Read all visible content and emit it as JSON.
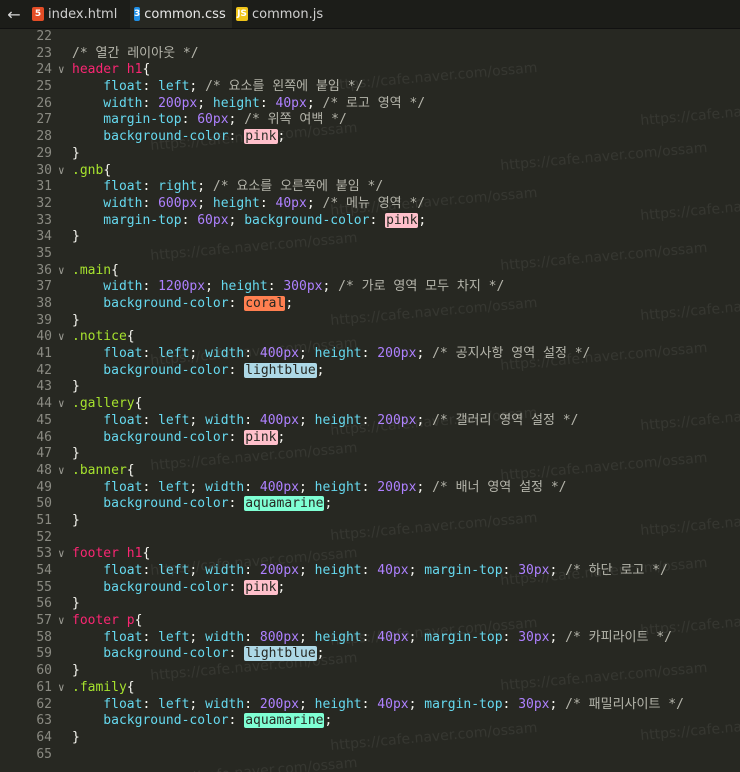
{
  "tabs": [
    {
      "label": "index.html",
      "icon": "html5-icon",
      "badge": "5",
      "color": "#e44d26",
      "active": false
    },
    {
      "label": "common.css",
      "icon": "css3-icon",
      "badge": "3",
      "color": "#1f8fe6",
      "active": true
    },
    {
      "label": "common.js",
      "icon": "js-icon",
      "badge": "JS",
      "color": "#f0c419",
      "active": false
    }
  ],
  "back_glyph": "←",
  "watermark": "https://cafe.naver.com/ossam",
  "colors": {
    "pink": "#ffc0cb",
    "coral": "#ff7f50",
    "lightblue": "#add8e6",
    "aquamarine": "#7fffd4"
  },
  "lines": [
    {
      "n": "22",
      "fold": false,
      "tokens": []
    },
    {
      "n": "23",
      "fold": false,
      "tokens": [
        {
          "t": "/* 열간 레이아웃 */",
          "c": "c"
        }
      ]
    },
    {
      "n": "24",
      "fold": true,
      "tokens": [
        {
          "t": "header h1",
          "c": "sel"
        },
        {
          "t": "{",
          "c": "brace"
        }
      ]
    },
    {
      "n": "25",
      "fold": false,
      "tokens": [
        {
          "t": "    float",
          "c": "prop"
        },
        {
          "t": ": ",
          "c": "punc"
        },
        {
          "t": "left",
          "c": "prop"
        },
        {
          "t": "; ",
          "c": "punc"
        },
        {
          "t": "/* 요소를 왼쪽에 붙임 */",
          "c": "c"
        }
      ]
    },
    {
      "n": "26",
      "fold": false,
      "tokens": [
        {
          "t": "    width",
          "c": "prop"
        },
        {
          "t": ": ",
          "c": "punc"
        },
        {
          "t": "200px",
          "c": "val"
        },
        {
          "t": "; ",
          "c": "punc"
        },
        {
          "t": "height",
          "c": "prop"
        },
        {
          "t": ": ",
          "c": "punc"
        },
        {
          "t": "40px",
          "c": "val"
        },
        {
          "t": "; ",
          "c": "punc"
        },
        {
          "t": "/* 로고 영역 */",
          "c": "c"
        }
      ]
    },
    {
      "n": "27",
      "fold": false,
      "tokens": [
        {
          "t": "    margin-top",
          "c": "prop"
        },
        {
          "t": ": ",
          "c": "punc"
        },
        {
          "t": "60px",
          "c": "val"
        },
        {
          "t": "; ",
          "c": "punc"
        },
        {
          "t": "/* 위쪽 여백 */",
          "c": "c"
        }
      ]
    },
    {
      "n": "28",
      "fold": false,
      "tokens": [
        {
          "t": "    background-color",
          "c": "prop"
        },
        {
          "t": ": ",
          "c": "punc"
        },
        {
          "t": "pink",
          "c": "chip",
          "bg": "pink"
        },
        {
          "t": ";",
          "c": "punc"
        }
      ]
    },
    {
      "n": "29",
      "fold": false,
      "tokens": [
        {
          "t": "}",
          "c": "brace"
        }
      ]
    },
    {
      "n": "30",
      "fold": true,
      "tokens": [
        {
          "t": ".gnb",
          "c": "cls"
        },
        {
          "t": "{",
          "c": "brace"
        }
      ]
    },
    {
      "n": "31",
      "fold": false,
      "tokens": [
        {
          "t": "    float",
          "c": "prop"
        },
        {
          "t": ": ",
          "c": "punc"
        },
        {
          "t": "right",
          "c": "prop"
        },
        {
          "t": "; ",
          "c": "punc"
        },
        {
          "t": "/* 요소를 오른쪽에 붙임 */",
          "c": "c"
        }
      ]
    },
    {
      "n": "32",
      "fold": false,
      "tokens": [
        {
          "t": "    width",
          "c": "prop"
        },
        {
          "t": ": ",
          "c": "punc"
        },
        {
          "t": "600px",
          "c": "val"
        },
        {
          "t": "; ",
          "c": "punc"
        },
        {
          "t": "height",
          "c": "prop"
        },
        {
          "t": ": ",
          "c": "punc"
        },
        {
          "t": "40px",
          "c": "val"
        },
        {
          "t": "; ",
          "c": "punc"
        },
        {
          "t": "/* 메뉴 영역 */",
          "c": "c"
        }
      ]
    },
    {
      "n": "33",
      "fold": false,
      "tokens": [
        {
          "t": "    margin-top",
          "c": "prop"
        },
        {
          "t": ": ",
          "c": "punc"
        },
        {
          "t": "60px",
          "c": "val"
        },
        {
          "t": "; ",
          "c": "punc"
        },
        {
          "t": "background-color",
          "c": "prop"
        },
        {
          "t": ": ",
          "c": "punc"
        },
        {
          "t": "pink",
          "c": "chip",
          "bg": "pink"
        },
        {
          "t": ";",
          "c": "punc"
        }
      ]
    },
    {
      "n": "34",
      "fold": false,
      "tokens": [
        {
          "t": "}",
          "c": "brace"
        }
      ]
    },
    {
      "n": "35",
      "fold": false,
      "tokens": []
    },
    {
      "n": "36",
      "fold": true,
      "tokens": [
        {
          "t": ".main",
          "c": "cls"
        },
        {
          "t": "{",
          "c": "brace"
        }
      ]
    },
    {
      "n": "37",
      "fold": false,
      "tokens": [
        {
          "t": "    width",
          "c": "prop"
        },
        {
          "t": ": ",
          "c": "punc"
        },
        {
          "t": "1200px",
          "c": "val"
        },
        {
          "t": "; ",
          "c": "punc"
        },
        {
          "t": "height",
          "c": "prop"
        },
        {
          "t": ": ",
          "c": "punc"
        },
        {
          "t": "300px",
          "c": "val"
        },
        {
          "t": "; ",
          "c": "punc"
        },
        {
          "t": "/* 가로 영역 모두 차지 */",
          "c": "c"
        }
      ]
    },
    {
      "n": "38",
      "fold": false,
      "tokens": [
        {
          "t": "    background-color",
          "c": "prop"
        },
        {
          "t": ": ",
          "c": "punc"
        },
        {
          "t": "coral",
          "c": "chip",
          "bg": "coral"
        },
        {
          "t": ";",
          "c": "punc"
        }
      ]
    },
    {
      "n": "39",
      "fold": false,
      "tokens": [
        {
          "t": "}",
          "c": "brace"
        }
      ]
    },
    {
      "n": "40",
      "fold": true,
      "tokens": [
        {
          "t": ".notice",
          "c": "cls"
        },
        {
          "t": "{",
          "c": "brace"
        }
      ]
    },
    {
      "n": "41",
      "fold": false,
      "tokens": [
        {
          "t": "    float",
          "c": "prop"
        },
        {
          "t": ": ",
          "c": "punc"
        },
        {
          "t": "left",
          "c": "prop"
        },
        {
          "t": "; ",
          "c": "punc"
        },
        {
          "t": "width",
          "c": "prop"
        },
        {
          "t": ": ",
          "c": "punc"
        },
        {
          "t": "400px",
          "c": "val"
        },
        {
          "t": "; ",
          "c": "punc"
        },
        {
          "t": "height",
          "c": "prop"
        },
        {
          "t": ": ",
          "c": "punc"
        },
        {
          "t": "200px",
          "c": "val"
        },
        {
          "t": "; ",
          "c": "punc"
        },
        {
          "t": "/* 공지사항 영역 설정 */",
          "c": "c"
        }
      ]
    },
    {
      "n": "42",
      "fold": false,
      "tokens": [
        {
          "t": "    background-color",
          "c": "prop"
        },
        {
          "t": ": ",
          "c": "punc"
        },
        {
          "t": "lightblue",
          "c": "chip",
          "bg": "lightblue"
        },
        {
          "t": ";",
          "c": "punc"
        }
      ]
    },
    {
      "n": "43",
      "fold": false,
      "tokens": [
        {
          "t": "}",
          "c": "brace"
        }
      ]
    },
    {
      "n": "44",
      "fold": true,
      "tokens": [
        {
          "t": ".gallery",
          "c": "cls"
        },
        {
          "t": "{",
          "c": "brace"
        }
      ]
    },
    {
      "n": "45",
      "fold": false,
      "tokens": [
        {
          "t": "    float",
          "c": "prop"
        },
        {
          "t": ": ",
          "c": "punc"
        },
        {
          "t": "left",
          "c": "prop"
        },
        {
          "t": "; ",
          "c": "punc"
        },
        {
          "t": "width",
          "c": "prop"
        },
        {
          "t": ": ",
          "c": "punc"
        },
        {
          "t": "400px",
          "c": "val"
        },
        {
          "t": "; ",
          "c": "punc"
        },
        {
          "t": "height",
          "c": "prop"
        },
        {
          "t": ": ",
          "c": "punc"
        },
        {
          "t": "200px",
          "c": "val"
        },
        {
          "t": "; ",
          "c": "punc"
        },
        {
          "t": "/* 갤러리 영역 설정 */",
          "c": "c"
        }
      ]
    },
    {
      "n": "46",
      "fold": false,
      "tokens": [
        {
          "t": "    background-color",
          "c": "prop"
        },
        {
          "t": ": ",
          "c": "punc"
        },
        {
          "t": "pink",
          "c": "chip",
          "bg": "pink"
        },
        {
          "t": ";",
          "c": "punc"
        }
      ]
    },
    {
      "n": "47",
      "fold": false,
      "tokens": [
        {
          "t": "}",
          "c": "brace"
        }
      ]
    },
    {
      "n": "48",
      "fold": true,
      "tokens": [
        {
          "t": ".banner",
          "c": "cls"
        },
        {
          "t": "{",
          "c": "brace"
        }
      ]
    },
    {
      "n": "49",
      "fold": false,
      "tokens": [
        {
          "t": "    float",
          "c": "prop"
        },
        {
          "t": ": ",
          "c": "punc"
        },
        {
          "t": "left",
          "c": "prop"
        },
        {
          "t": "; ",
          "c": "punc"
        },
        {
          "t": "width",
          "c": "prop"
        },
        {
          "t": ": ",
          "c": "punc"
        },
        {
          "t": "400px",
          "c": "val"
        },
        {
          "t": "; ",
          "c": "punc"
        },
        {
          "t": "height",
          "c": "prop"
        },
        {
          "t": ": ",
          "c": "punc"
        },
        {
          "t": "200px",
          "c": "val"
        },
        {
          "t": "; ",
          "c": "punc"
        },
        {
          "t": "/* 배너 영역 설정 */",
          "c": "c"
        }
      ]
    },
    {
      "n": "50",
      "fold": false,
      "tokens": [
        {
          "t": "    background-color",
          "c": "prop"
        },
        {
          "t": ": ",
          "c": "punc"
        },
        {
          "t": "aquamarine",
          "c": "chip",
          "bg": "aquamarine"
        },
        {
          "t": ";",
          "c": "punc"
        }
      ]
    },
    {
      "n": "51",
      "fold": false,
      "tokens": [
        {
          "t": "}",
          "c": "brace"
        }
      ]
    },
    {
      "n": "52",
      "fold": false,
      "tokens": []
    },
    {
      "n": "53",
      "fold": true,
      "tokens": [
        {
          "t": "footer h1",
          "c": "sel"
        },
        {
          "t": "{",
          "c": "brace"
        }
      ]
    },
    {
      "n": "54",
      "fold": false,
      "tokens": [
        {
          "t": "    float",
          "c": "prop"
        },
        {
          "t": ": ",
          "c": "punc"
        },
        {
          "t": "left",
          "c": "prop"
        },
        {
          "t": "; ",
          "c": "punc"
        },
        {
          "t": "width",
          "c": "prop"
        },
        {
          "t": ": ",
          "c": "punc"
        },
        {
          "t": "200px",
          "c": "val"
        },
        {
          "t": "; ",
          "c": "punc"
        },
        {
          "t": "height",
          "c": "prop"
        },
        {
          "t": ": ",
          "c": "punc"
        },
        {
          "t": "40px",
          "c": "val"
        },
        {
          "t": "; ",
          "c": "punc"
        },
        {
          "t": "margin-top",
          "c": "prop"
        },
        {
          "t": ": ",
          "c": "punc"
        },
        {
          "t": "30px",
          "c": "val"
        },
        {
          "t": "; ",
          "c": "punc"
        },
        {
          "t": "/* 하단 로고 */",
          "c": "c"
        }
      ]
    },
    {
      "n": "55",
      "fold": false,
      "tokens": [
        {
          "t": "    background-color",
          "c": "prop"
        },
        {
          "t": ": ",
          "c": "punc"
        },
        {
          "t": "pink",
          "c": "chip",
          "bg": "pink"
        },
        {
          "t": ";",
          "c": "punc"
        }
      ]
    },
    {
      "n": "56",
      "fold": false,
      "tokens": [
        {
          "t": "}",
          "c": "brace"
        }
      ]
    },
    {
      "n": "57",
      "fold": true,
      "tokens": [
        {
          "t": "footer p",
          "c": "sel"
        },
        {
          "t": "{",
          "c": "brace"
        }
      ]
    },
    {
      "n": "58",
      "fold": false,
      "tokens": [
        {
          "t": "    float",
          "c": "prop"
        },
        {
          "t": ": ",
          "c": "punc"
        },
        {
          "t": "left",
          "c": "prop"
        },
        {
          "t": "; ",
          "c": "punc"
        },
        {
          "t": "width",
          "c": "prop"
        },
        {
          "t": ": ",
          "c": "punc"
        },
        {
          "t": "800px",
          "c": "val"
        },
        {
          "t": "; ",
          "c": "punc"
        },
        {
          "t": "height",
          "c": "prop"
        },
        {
          "t": ": ",
          "c": "punc"
        },
        {
          "t": "40px",
          "c": "val"
        },
        {
          "t": "; ",
          "c": "punc"
        },
        {
          "t": "margin-top",
          "c": "prop"
        },
        {
          "t": ": ",
          "c": "punc"
        },
        {
          "t": "30px",
          "c": "val"
        },
        {
          "t": "; ",
          "c": "punc"
        },
        {
          "t": "/* 카피라이트 */",
          "c": "c"
        }
      ]
    },
    {
      "n": "59",
      "fold": false,
      "tokens": [
        {
          "t": "    background-color",
          "c": "prop"
        },
        {
          "t": ": ",
          "c": "punc"
        },
        {
          "t": "lightblue",
          "c": "chip",
          "bg": "lightblue"
        },
        {
          "t": ";",
          "c": "punc"
        }
      ]
    },
    {
      "n": "60",
      "fold": false,
      "tokens": [
        {
          "t": "}",
          "c": "brace"
        }
      ]
    },
    {
      "n": "61",
      "fold": true,
      "tokens": [
        {
          "t": ".family",
          "c": "cls"
        },
        {
          "t": "{",
          "c": "brace"
        }
      ]
    },
    {
      "n": "62",
      "fold": false,
      "tokens": [
        {
          "t": "    float",
          "c": "prop"
        },
        {
          "t": ": ",
          "c": "punc"
        },
        {
          "t": "left",
          "c": "prop"
        },
        {
          "t": "; ",
          "c": "punc"
        },
        {
          "t": "width",
          "c": "prop"
        },
        {
          "t": ": ",
          "c": "punc"
        },
        {
          "t": "200px",
          "c": "val"
        },
        {
          "t": "; ",
          "c": "punc"
        },
        {
          "t": "height",
          "c": "prop"
        },
        {
          "t": ": ",
          "c": "punc"
        },
        {
          "t": "40px",
          "c": "val"
        },
        {
          "t": "; ",
          "c": "punc"
        },
        {
          "t": "margin-top",
          "c": "prop"
        },
        {
          "t": ": ",
          "c": "punc"
        },
        {
          "t": "30px",
          "c": "val"
        },
        {
          "t": "; ",
          "c": "punc"
        },
        {
          "t": "/* 패밀리사이트 */",
          "c": "c"
        }
      ]
    },
    {
      "n": "63",
      "fold": false,
      "tokens": [
        {
          "t": "    background-color",
          "c": "prop"
        },
        {
          "t": ": ",
          "c": "punc"
        },
        {
          "t": "aquamarine",
          "c": "chip",
          "bg": "aquamarine"
        },
        {
          "t": ";",
          "c": "punc"
        }
      ]
    },
    {
      "n": "64",
      "fold": false,
      "tokens": [
        {
          "t": "}",
          "c": "brace"
        }
      ]
    },
    {
      "n": "65",
      "fold": false,
      "tokens": []
    }
  ]
}
